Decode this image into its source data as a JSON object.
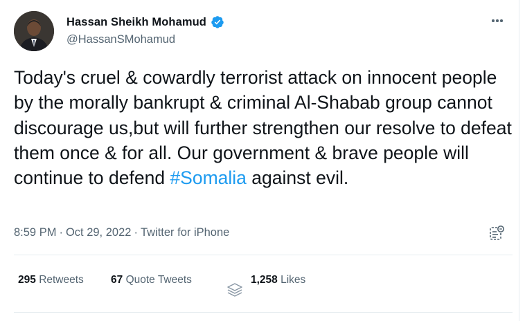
{
  "author": {
    "display_name": "Hassan Sheikh Mohamud",
    "handle": "@HassanSMohamud",
    "verified": true
  },
  "tweet": {
    "text_before": "Today's cruel & cowardly terrorist attack on innocent people by the morally bankrupt & criminal Al-Shabab group cannot discourage us,but will further strengthen our resolve to defeat them once & for all. Our government & brave people will continue to defend ",
    "hashtag": "#Somalia",
    "text_after": " against evil."
  },
  "meta": {
    "time": "8:59 PM",
    "separator1": "·",
    "date": "Oct 29, 2022",
    "separator2": "·",
    "source": "Twitter for iPhone"
  },
  "stats": {
    "retweets_count": "295",
    "retweets_label": "Retweets",
    "quotes_count": "67",
    "quotes_label": "Quote Tweets",
    "likes_count": "1,258",
    "likes_label": "Likes"
  },
  "icons": {
    "verified": "verified-badge-icon",
    "more": "more-options-icon",
    "analytics": "analytics-icon",
    "layers": "layers-icon"
  },
  "colors": {
    "link": "#1d9bf0",
    "secondary": "#536471",
    "primary": "#0f1419",
    "divider": "#e6ecf0"
  }
}
